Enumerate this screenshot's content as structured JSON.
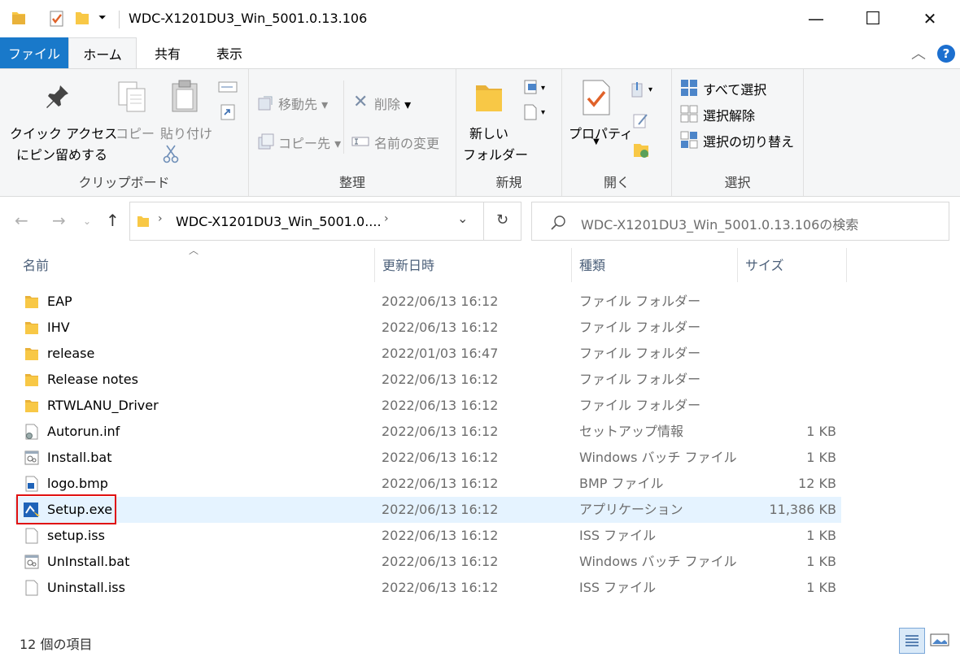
{
  "window": {
    "title": "WDC-X1201DU3_Win_5001.0.13.106",
    "minimize": "—",
    "maximize": "☐",
    "close": "✕"
  },
  "tabs": {
    "file": "ファイル",
    "home": "ホーム",
    "share": "共有",
    "view": "表示"
  },
  "ribbon": {
    "clipboard": {
      "label": "クリップボード",
      "pin_line1": "クイック アクセス",
      "pin_line2": "にピン留めする",
      "copy": "コピー",
      "paste": "貼り付け"
    },
    "organize": {
      "label": "整理",
      "move_to": "移動先",
      "copy_to": "コピー先",
      "delete": "削除",
      "rename": "名前の変更"
    },
    "new": {
      "label": "新規",
      "new_folder_line1": "新しい",
      "new_folder_line2": "フォルダー"
    },
    "open": {
      "label": "開く",
      "properties": "プロパティ"
    },
    "select": {
      "label": "選択",
      "select_all": "すべて選択",
      "select_none": "選択解除",
      "invert": "選択の切り替え"
    }
  },
  "nav": {
    "address": "WDC-X1201DU3_Win_5001.0....",
    "search_placeholder": "WDC-X1201DU3_Win_5001.0.13.106の検索"
  },
  "columns": {
    "name": "名前",
    "date": "更新日時",
    "type": "種類",
    "size": "サイズ"
  },
  "files": [
    {
      "name": "EAP",
      "date": "2022/06/13 16:12",
      "type": "ファイル フォルダー",
      "size": "",
      "icon": "folder-icon"
    },
    {
      "name": "IHV",
      "date": "2022/06/13 16:12",
      "type": "ファイル フォルダー",
      "size": "",
      "icon": "folder-icon"
    },
    {
      "name": "release",
      "date": "2022/01/03 16:47",
      "type": "ファイル フォルダー",
      "size": "",
      "icon": "folder-icon"
    },
    {
      "name": "Release notes",
      "date": "2022/06/13 16:12",
      "type": "ファイル フォルダー",
      "size": "",
      "icon": "folder-icon"
    },
    {
      "name": "RTWLANU_Driver",
      "date": "2022/06/13 16:12",
      "type": "ファイル フォルダー",
      "size": "",
      "icon": "folder-icon"
    },
    {
      "name": "Autorun.inf",
      "date": "2022/06/13 16:12",
      "type": "セットアップ情報",
      "size": "1 KB",
      "icon": "setup-info-icon"
    },
    {
      "name": "Install.bat",
      "date": "2022/06/13 16:12",
      "type": "Windows バッチ ファイル",
      "size": "1 KB",
      "icon": "batch-file-icon"
    },
    {
      "name": "logo.bmp",
      "date": "2022/06/13 16:12",
      "type": "BMP ファイル",
      "size": "12 KB",
      "icon": "bitmap-icon"
    },
    {
      "name": "Setup.exe",
      "date": "2022/06/13 16:12",
      "type": "アプリケーション",
      "size": "11,386 KB",
      "icon": "setup-exe-icon"
    },
    {
      "name": "setup.iss",
      "date": "2022/06/13 16:12",
      "type": "ISS ファイル",
      "size": "1 KB",
      "icon": "blank-file-icon"
    },
    {
      "name": "UnInstall.bat",
      "date": "2022/06/13 16:12",
      "type": "Windows バッチ ファイル",
      "size": "1 KB",
      "icon": "batch-file-icon"
    },
    {
      "name": "Uninstall.iss",
      "date": "2022/06/13 16:12",
      "type": "ISS ファイル",
      "size": "1 KB",
      "icon": "blank-file-icon"
    }
  ],
  "status": {
    "item_count": "12 個の項目"
  },
  "colors": {
    "accent": "#1979ca",
    "selection": "#e5f3ff",
    "highlight": "#e01010",
    "folder": "#f8c846"
  }
}
